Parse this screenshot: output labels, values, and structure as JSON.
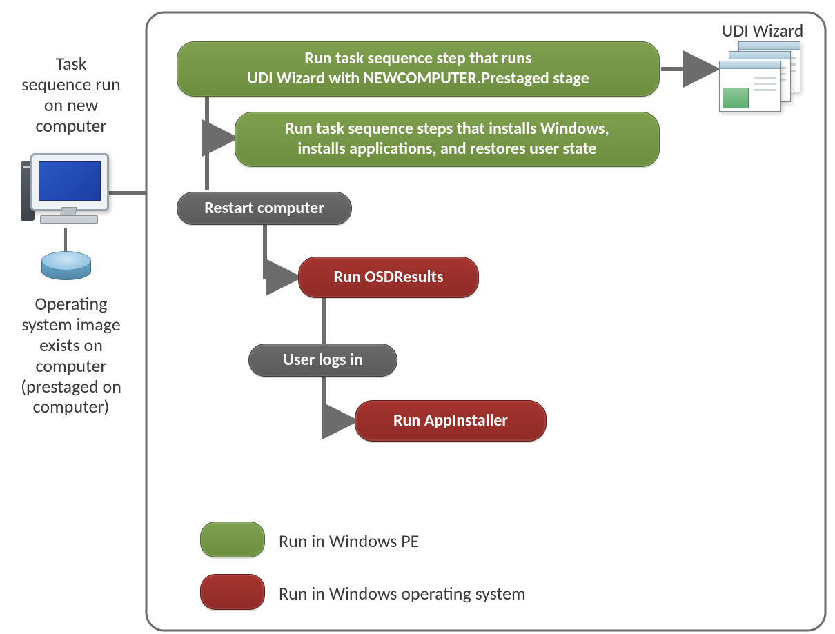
{
  "labels": {
    "task_sequence_title_l1": "Task",
    "task_sequence_title_l2": "sequence run",
    "task_sequence_title_l3": "on new",
    "task_sequence_title_l4": "computer",
    "os_image_l1": "Operating",
    "os_image_l2": "system image",
    "os_image_l3": "exists on",
    "os_image_l4": "computer",
    "os_image_l5": "(prestaged on",
    "os_image_l6": "computer)",
    "udi_wizard": "UDI Wizard"
  },
  "nodes": {
    "step1_l1": "Run task sequence step  that runs",
    "step1_l2": "UDI Wizard with NEWCOMPUTER.Prestaged  stage",
    "step2_l1": "Run task sequence steps that installs Windows,",
    "step2_l2": "installs applications, and restores user state",
    "restart": "Restart computer",
    "osdresults": "Run OSDResults",
    "userlogs": "User logs in",
    "appinstaller": "Run AppInstaller"
  },
  "legend": {
    "pe": "Run in Windows  PE",
    "os": "Run in Windows operating system"
  },
  "colors": {
    "green": "#6c8e3f",
    "gray": "#5a5a5a",
    "red": "#8f2b27",
    "border": "#6c6c6c"
  }
}
